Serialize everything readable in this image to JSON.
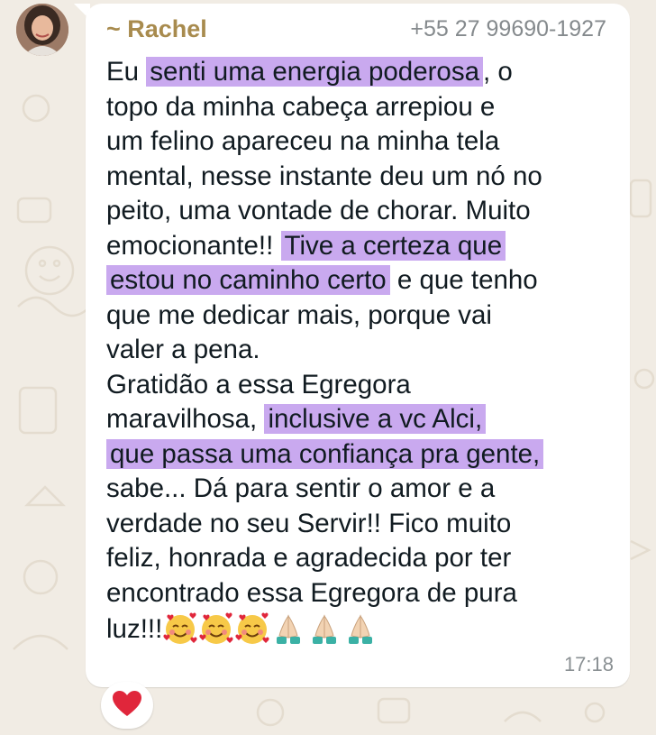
{
  "chat": {
    "sender_name": "~ Rachel",
    "sender_phone": "+55 27 99690-1927",
    "time": "17:18",
    "reaction": "heart",
    "message_lines": [
      [
        {
          "t": "Eu "
        },
        {
          "t": "senti uma energia poderosa",
          "hl": true
        },
        {
          "t": ", o"
        }
      ],
      [
        {
          "t": "topo da minha cabeça arrepiou e"
        }
      ],
      [
        {
          "t": "um felino apareceu na minha tela"
        }
      ],
      [
        {
          "t": "mental, nesse instante deu um nó no"
        }
      ],
      [
        {
          "t": "peito, uma vontade de chorar. Muito"
        }
      ],
      [
        {
          "t": "emocionante!! "
        },
        {
          "t": "Tive a certeza que",
          "hl": true
        }
      ],
      [
        {
          "t": "estou no caminho certo",
          "hl": true
        },
        {
          "t": " e que tenho"
        }
      ],
      [
        {
          "t": "que me dedicar mais, porque vai"
        }
      ],
      [
        {
          "t": "valer a pena."
        }
      ],
      [
        {
          "t": "Gratidão a essa Egregora"
        }
      ],
      [
        {
          "t": "maravilhosa, "
        },
        {
          "t": "inclusive a vc Alci,",
          "hl": true
        }
      ],
      [
        {
          "t": "que passa uma confiança pra gente,",
          "hl": true
        }
      ],
      [
        {
          "t": "sabe... Dá para sentir o amor e a"
        }
      ],
      [
        {
          "t": "verdade no seu Servir!! Fico muito"
        }
      ],
      [
        {
          "t": "feliz, honrada e agradecida por ter"
        }
      ],
      [
        {
          "t": "encontrado essa Egregora de pura"
        }
      ],
      [
        {
          "t": "luz!!!"
        },
        {
          "emoji": "smiling-face-with-hearts"
        },
        {
          "emoji": "smiling-face-with-hearts"
        },
        {
          "emoji": "smiling-face-with-hearts"
        },
        {
          "emoji": "folded-hands"
        },
        {
          "emoji": "folded-hands"
        },
        {
          "emoji": "folded-hands"
        }
      ]
    ]
  },
  "colors": {
    "highlight": "#c9a9ef",
    "sender_name": "#a88b4e",
    "bubble": "#ffffff",
    "wallpaper": "#f1ece4"
  }
}
